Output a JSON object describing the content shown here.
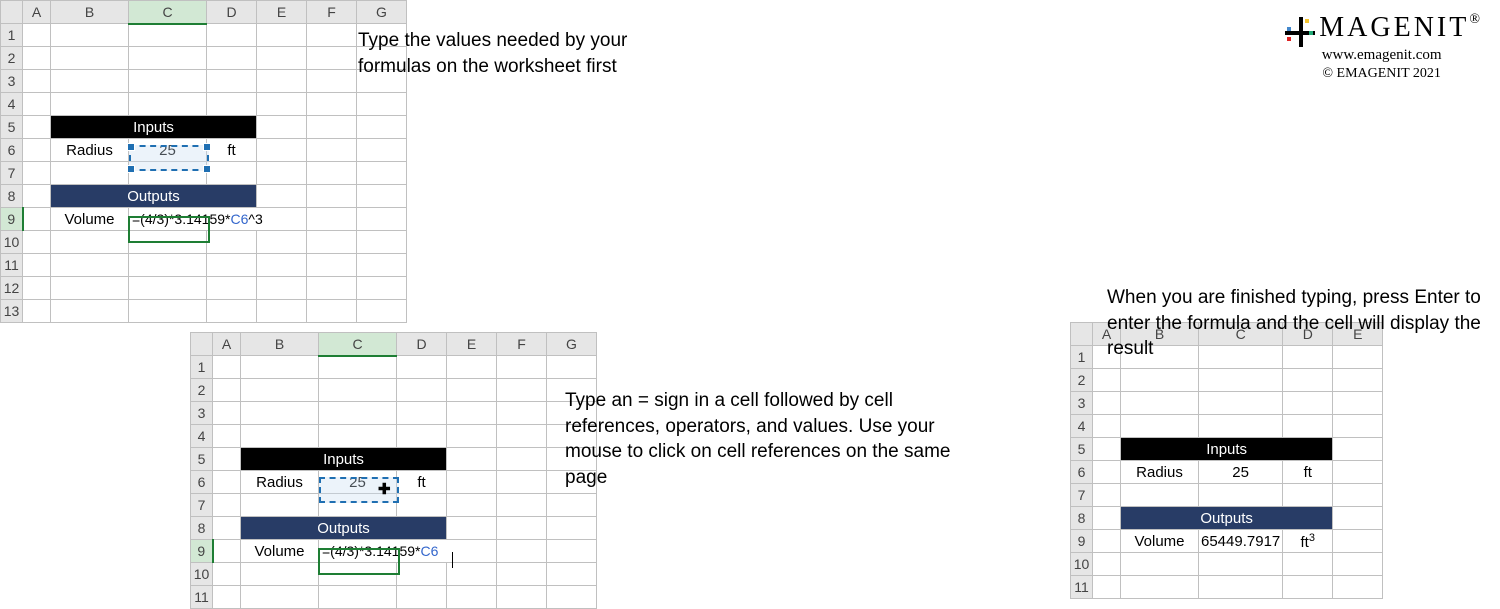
{
  "branding": {
    "name": "MAGENIT",
    "url": "www.emagenit.com",
    "copyright": "© EMAGENIT 2021"
  },
  "caption1": "Type the values needed by your formulas on the worksheet first",
  "caption2": "Type an = sign in a cell followed by cell references, operators, and values. Use your mouse to click on cell references on the same page",
  "caption3": "When you are finished typing, press Enter to enter the formula and the cell will display the result",
  "columns": [
    "A",
    "B",
    "C",
    "D",
    "E",
    "F",
    "G"
  ],
  "columns5": [
    "A",
    "B",
    "C",
    "D",
    "E"
  ],
  "rows13": [
    "1",
    "2",
    "3",
    "4",
    "5",
    "6",
    "7",
    "8",
    "9",
    "10",
    "11",
    "12",
    "13"
  ],
  "rows11": [
    "1",
    "2",
    "3",
    "4",
    "5",
    "6",
    "7",
    "8",
    "9",
    "10",
    "11"
  ],
  "labels": {
    "inputs": "Inputs",
    "outputs": "Outputs",
    "radius": "Radius",
    "volume": "Volume",
    "ft": "ft",
    "ft3": "ft",
    "ft3sup": "3",
    "radiusVal": "25",
    "resultVal": "65449.7917"
  },
  "formula": {
    "prefix": "=(4/3)*3.14159*",
    "ref": "C6",
    "suffix1": "",
    "suffix2": "^3"
  }
}
